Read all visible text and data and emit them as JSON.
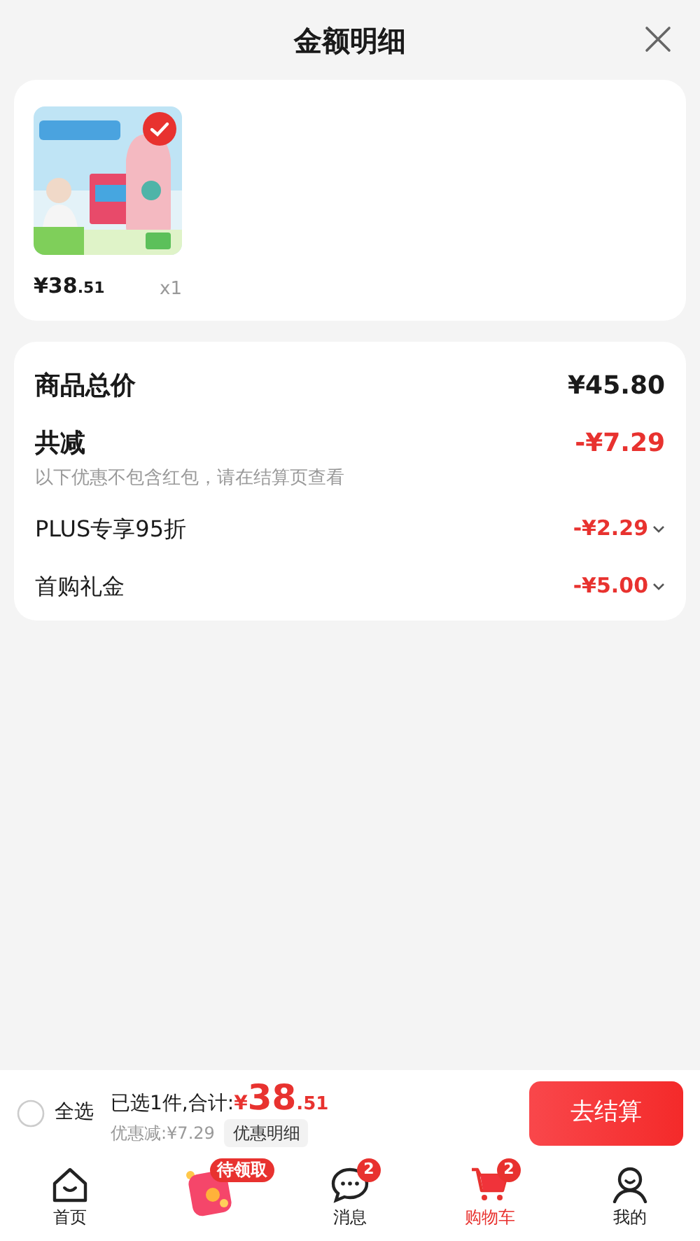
{
  "title": "金额明细",
  "product": {
    "price_symbol": "¥",
    "price_integer": "38",
    "price_decimal": ".51",
    "quantity": "x1"
  },
  "summary": {
    "total_label": "商品总价",
    "total_value": "¥45.80",
    "reduction_label": "共减",
    "reduction_value": "-¥7.29",
    "reduction_note": "以下优惠不包含红包，请在结算页查看",
    "discounts": [
      {
        "label": "PLUS专享95折",
        "value": "-¥2.29"
      },
      {
        "label": "首购礼金",
        "value": "-¥5.00"
      }
    ]
  },
  "checkout_bar": {
    "select_all": {
      "label": "全选",
      "checked": false
    },
    "selected_text": "已选1件,合计:",
    "price_symbol": "¥",
    "price_integer": "38",
    "price_decimal": ".51",
    "savings": "优惠减:¥7.29",
    "details_button": "优惠明细",
    "checkout_button": "去结算"
  },
  "tab_bar": [
    {
      "kind": "home",
      "label": "首页",
      "selected": false
    },
    {
      "kind": "gift",
      "badge": "待领取",
      "selected": false
    },
    {
      "kind": "message",
      "label": "消息",
      "badge": "2",
      "selected": false
    },
    {
      "kind": "cart",
      "label": "购物车",
      "badge": "2",
      "selected": true
    },
    {
      "kind": "profile",
      "label": "我的",
      "selected": false
    }
  ]
}
